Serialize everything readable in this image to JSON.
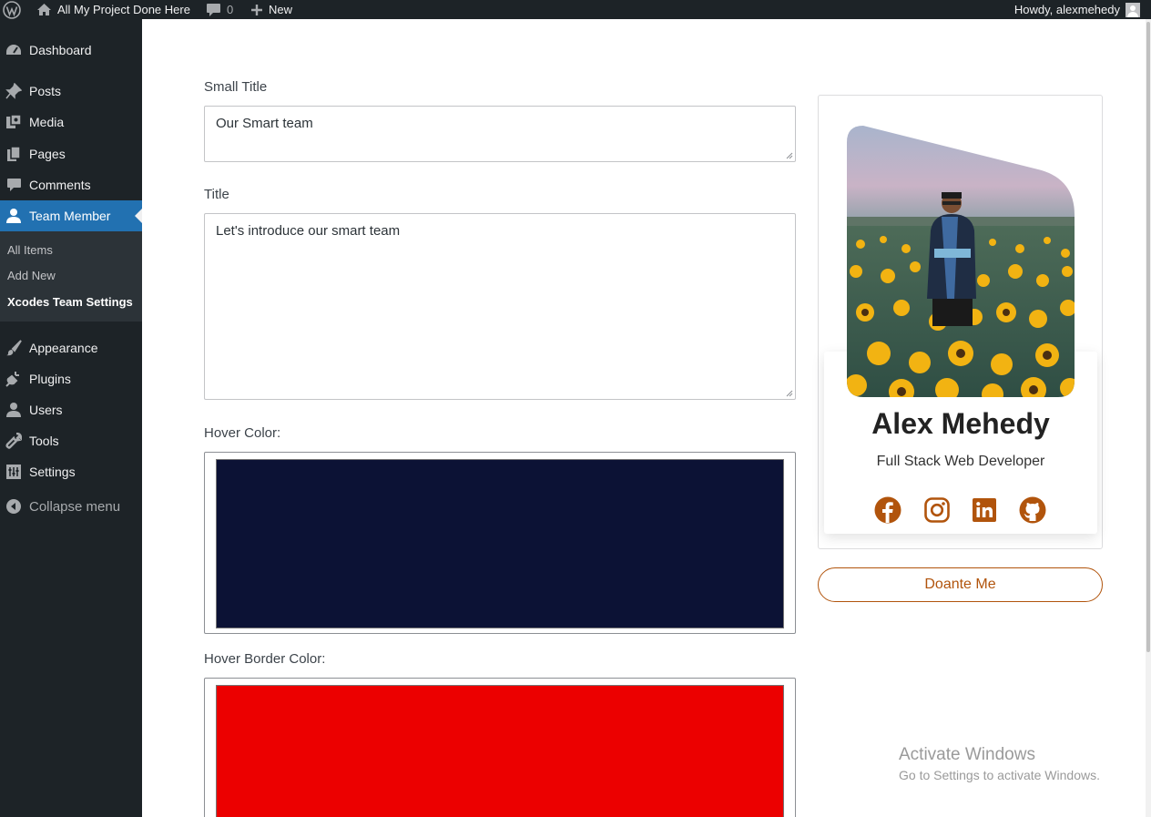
{
  "admin_bar": {
    "site_name": "All My Project Done Here",
    "comments_count": "0",
    "new_label": "New",
    "account_label": "Howdy, alexmehedy"
  },
  "sidebar": {
    "items": [
      {
        "label": "Dashboard",
        "icon": "dashboard-icon"
      },
      {
        "label": "Posts",
        "icon": "pin-icon"
      },
      {
        "label": "Media",
        "icon": "media-icon"
      },
      {
        "label": "Pages",
        "icon": "pages-icon"
      },
      {
        "label": "Comments",
        "icon": "comment-icon"
      },
      {
        "label": "Team Member",
        "icon": "user-icon",
        "current": true
      },
      {
        "label": "Appearance",
        "icon": "brush-icon"
      },
      {
        "label": "Plugins",
        "icon": "plugin-icon"
      },
      {
        "label": "Users",
        "icon": "users-icon"
      },
      {
        "label": "Tools",
        "icon": "wrench-icon"
      },
      {
        "label": "Settings",
        "icon": "settings-icon"
      }
    ],
    "submenu": [
      {
        "label": "All Items"
      },
      {
        "label": "Add New"
      },
      {
        "label": "Xcodes Team Settings",
        "active": true
      }
    ],
    "collapse_label": "Collapse menu"
  },
  "form": {
    "small_title": {
      "label": "Small Title",
      "value": "Our Smart team"
    },
    "title": {
      "label": "Title",
      "value": "Let's introduce our smart team"
    },
    "hover_color": {
      "label": "Hover Color:",
      "value": "#0c1235"
    },
    "hover_border_color": {
      "label": "Hover Border Color:",
      "value": "#ec0000"
    }
  },
  "card": {
    "name": "Alex Mehedy",
    "role": "Full Stack Web Developer",
    "social": [
      "facebook-icon",
      "instagram-icon",
      "linkedin-icon",
      "github-icon"
    ],
    "accent_color": "#b1540c",
    "donate_label": "Doante Me"
  },
  "watermark": {
    "title": "Activate Windows",
    "subtitle": "Go to Settings to activate Windows."
  }
}
